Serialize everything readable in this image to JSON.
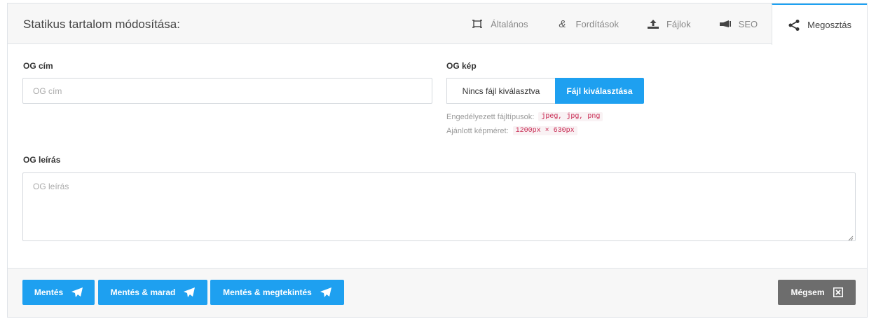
{
  "header": {
    "title": "Statikus tartalom módosítása:",
    "tabs": [
      {
        "label": "Általános",
        "icon": "expand-icon"
      },
      {
        "label": "Fordítások",
        "icon": "ampersand-icon"
      },
      {
        "label": "Fájlok",
        "icon": "upload-icon"
      },
      {
        "label": "SEO",
        "icon": "megaphone-icon"
      },
      {
        "label": "Megosztás",
        "icon": "share-icon"
      }
    ],
    "active_tab": "Megosztás"
  },
  "form": {
    "og_title_label": "OG cím",
    "og_title_placeholder": "OG cím",
    "og_title_value": "",
    "og_image_label": "OG kép",
    "file_status": "Nincs fájl kiválasztva",
    "file_button": "Fájl kiválasztása",
    "allowed_types_label": "Engedélyezett fájltípusok:",
    "allowed_types_value": "jpeg, jpg, png",
    "recommended_size_label": "Ajánlott képméret:",
    "recommended_size_value": "1200px × 630px",
    "og_desc_label": "OG leírás",
    "og_desc_placeholder": "OG leírás",
    "og_desc_value": ""
  },
  "footer": {
    "save": "Mentés",
    "save_stay": "Mentés & marad",
    "save_view": "Mentés & megtekintés",
    "cancel": "Mégsem"
  },
  "colors": {
    "accent": "#1ea0f0",
    "cancel": "#6d6d6d",
    "code_text": "#c7254e"
  }
}
